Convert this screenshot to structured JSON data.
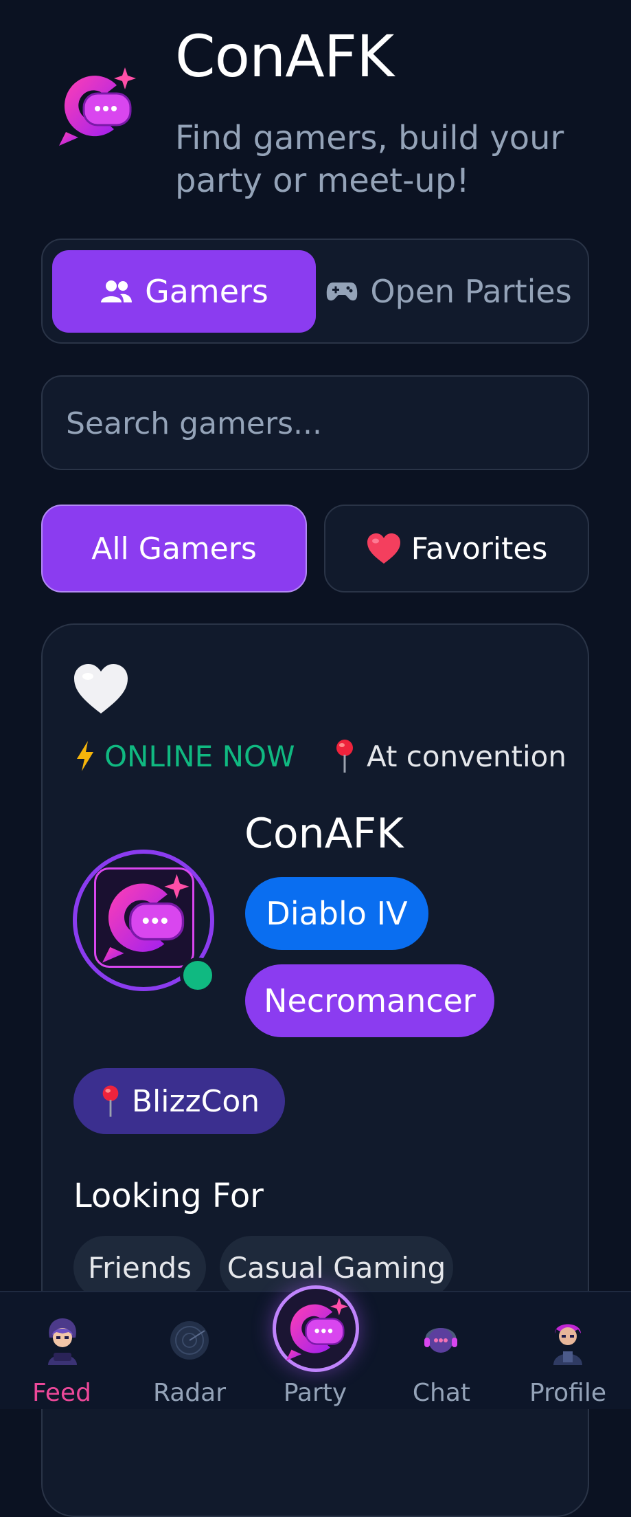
{
  "header": {
    "app_title": "ConAFK",
    "subtitle": "Find gamers, build your party or meet-up!"
  },
  "segmented": {
    "gamers_label": "Gamers",
    "parties_label": "Open Parties"
  },
  "search": {
    "placeholder": "Search gamers..."
  },
  "filters": {
    "all_label": "All Gamers",
    "favorites_label": "Favorites"
  },
  "card": {
    "online_text": "ONLINE NOW",
    "location_status": "At convention",
    "name": "ConAFK",
    "game": "Diablo IV",
    "class": "Necromancer",
    "event": "BlizzCon",
    "looking_for_title": "Looking For",
    "looking_for": [
      "Friends",
      "Casual Gaming"
    ]
  },
  "nav": {
    "items": [
      {
        "label": "Feed",
        "icon": "feed-avatar-icon"
      },
      {
        "label": "Radar",
        "icon": "radar-icon"
      },
      {
        "label": "Party",
        "icon": "party-logo-icon"
      },
      {
        "label": "Chat",
        "icon": "chat-icon"
      },
      {
        "label": "Profile",
        "icon": "profile-avatar-icon"
      }
    ]
  },
  "colors": {
    "background": "#0b1222",
    "accent_purple": "#8b3cf0",
    "online_green": "#10b981",
    "game_blue": "#0a6ef0",
    "feed_active_pink": "#ec4899"
  }
}
